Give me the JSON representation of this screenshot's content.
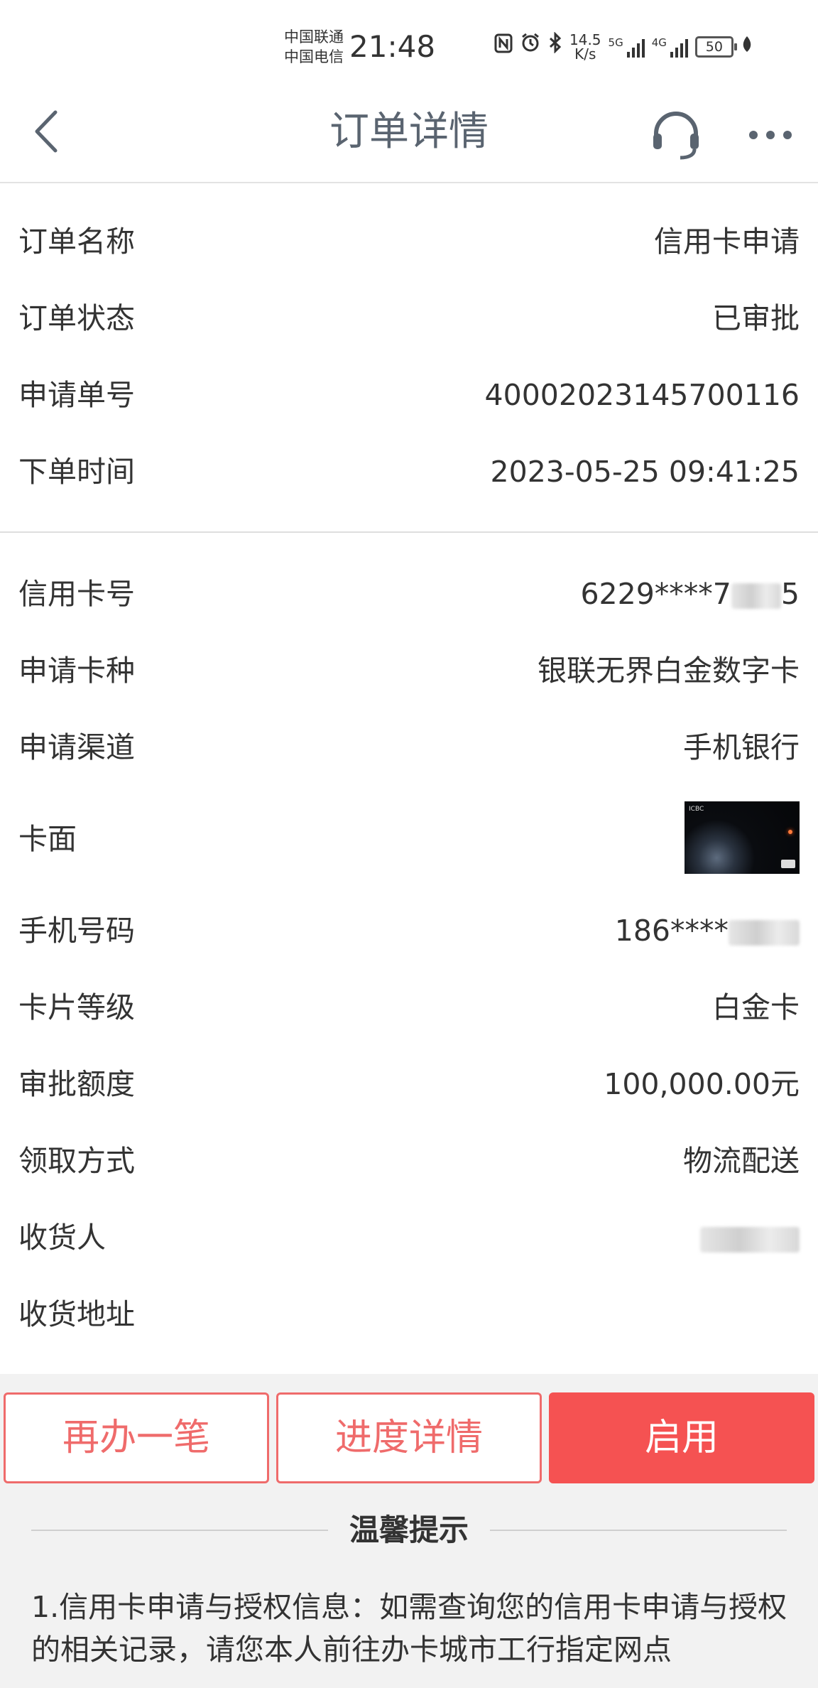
{
  "status_bar": {
    "carrier1": "中国联通",
    "carrier2": "中国电信",
    "time": "21:48",
    "speed_value": "14.5",
    "speed_unit": "K/s",
    "net1": "5G",
    "net2": "4G",
    "battery": "50"
  },
  "nav": {
    "title": "订单详情"
  },
  "order_info": [
    {
      "label": "订单名称",
      "value": "信用卡申请"
    },
    {
      "label": "订单状态",
      "value": "已审批"
    },
    {
      "label": "申请单号",
      "value": "40002023145700116"
    },
    {
      "label": "下单时间",
      "value": "2023-05-25 09:41:25"
    }
  ],
  "card_info": {
    "card_number": {
      "label": "信用卡号",
      "value": "6229****7"
    },
    "card_type": {
      "label": "申请卡种",
      "value": "银联无界白金数字卡"
    },
    "channel": {
      "label": "申请渠道",
      "value": "手机银行"
    },
    "card_face": {
      "label": "卡面",
      "brand": "ICBC"
    },
    "phone": {
      "label": "手机号码",
      "value": "186****"
    },
    "level": {
      "label": "卡片等级",
      "value": "白金卡"
    },
    "limit": {
      "label": "审批额度",
      "value": "100,000.00元"
    },
    "pickup": {
      "label": "领取方式",
      "value": "物流配送"
    },
    "receiver": {
      "label": "收货人",
      "value": ""
    },
    "address": {
      "label": "收货地址",
      "value": ""
    }
  },
  "actions": {
    "again": "再办一笔",
    "progress": "进度详情",
    "activate": "启用"
  },
  "tips": {
    "title": "温馨提示",
    "text": "1.信用卡申请与授权信息：如需查询您的信用卡申请与授权的相关记录，请您本人前往办卡城市工行指定网点"
  },
  "colors": {
    "accent_red": "#f55252",
    "outline_red": "#ef6b6b"
  }
}
